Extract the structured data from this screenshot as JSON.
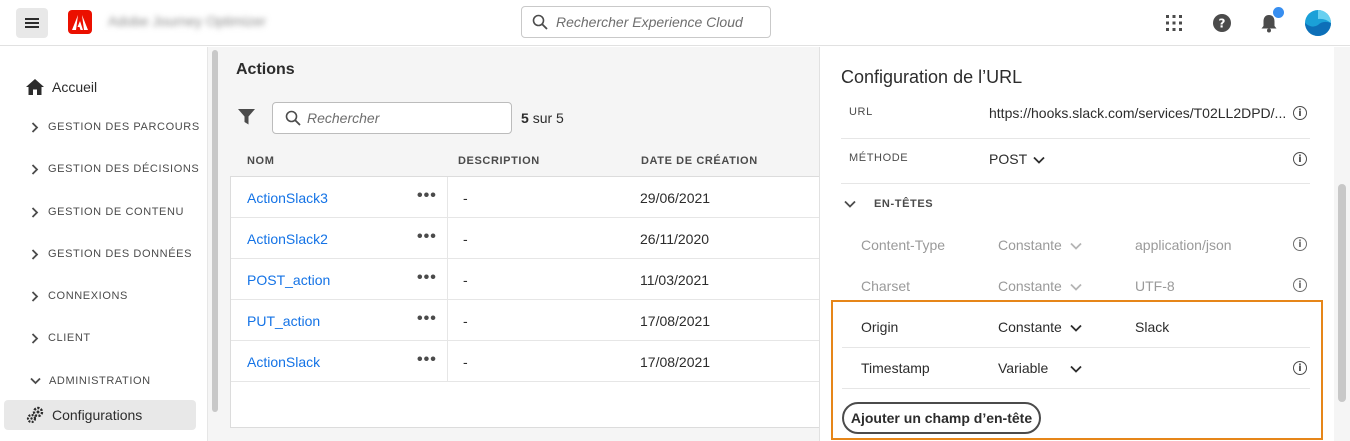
{
  "topbar": {
    "app_name": "Adobe Journey Optimizer",
    "search_placeholder": "Rechercher Experience Cloud"
  },
  "leftnav": {
    "home": "Accueil",
    "sections": [
      "GESTION DES PARCOURS",
      "GESTION DES DÉCISIONS",
      "GESTION DE CONTENU",
      "GESTION DES DONNÉES",
      "CONNEXIONS",
      "CLIENT",
      "ADMINISTRATION"
    ],
    "active_item": "Configurations"
  },
  "main": {
    "title": "Actions",
    "search_placeholder": "Rechercher",
    "count_bold": "5",
    "count_rest": "sur 5",
    "columns": [
      "NOM",
      "DESCRIPTION",
      "DATE DE CRÉATION"
    ],
    "rows": [
      {
        "name": "ActionSlack3",
        "description": "-",
        "date": "29/06/2021"
      },
      {
        "name": "ActionSlack2",
        "description": "-",
        "date": "26/11/2020"
      },
      {
        "name": "POST_action",
        "description": "-",
        "date": "11/03/2021"
      },
      {
        "name": "PUT_action",
        "description": "-",
        "date": "17/08/2021"
      },
      {
        "name": "ActionSlack",
        "description": "-",
        "date": "17/08/2021"
      }
    ],
    "more_glyph": "•••"
  },
  "panel": {
    "title": "Configuration de l’URL",
    "url_label": "URL",
    "url_value": "https://hooks.slack.com/services/T02LL2DPD/...",
    "method_label": "MÉTHODE",
    "method_value": "POST",
    "headers_label": "EN-TÊTES",
    "headers": [
      {
        "key": "Content-Type",
        "type": "Constante",
        "value": "application/json"
      },
      {
        "key": "Charset",
        "type": "Constante",
        "value": "UTF-8"
      },
      {
        "key": "Origin",
        "type": "Constante",
        "value": "Slack"
      },
      {
        "key": "Timestamp",
        "type": "Variable",
        "value": ""
      }
    ],
    "add_header_button": "Ajouter un champ d’en-tête",
    "info_glyph": "i"
  },
  "colors": {
    "link": "#1473e6",
    "highlight": "#e68619",
    "adobe_red": "#eb1000",
    "notification": "#378ef0"
  }
}
